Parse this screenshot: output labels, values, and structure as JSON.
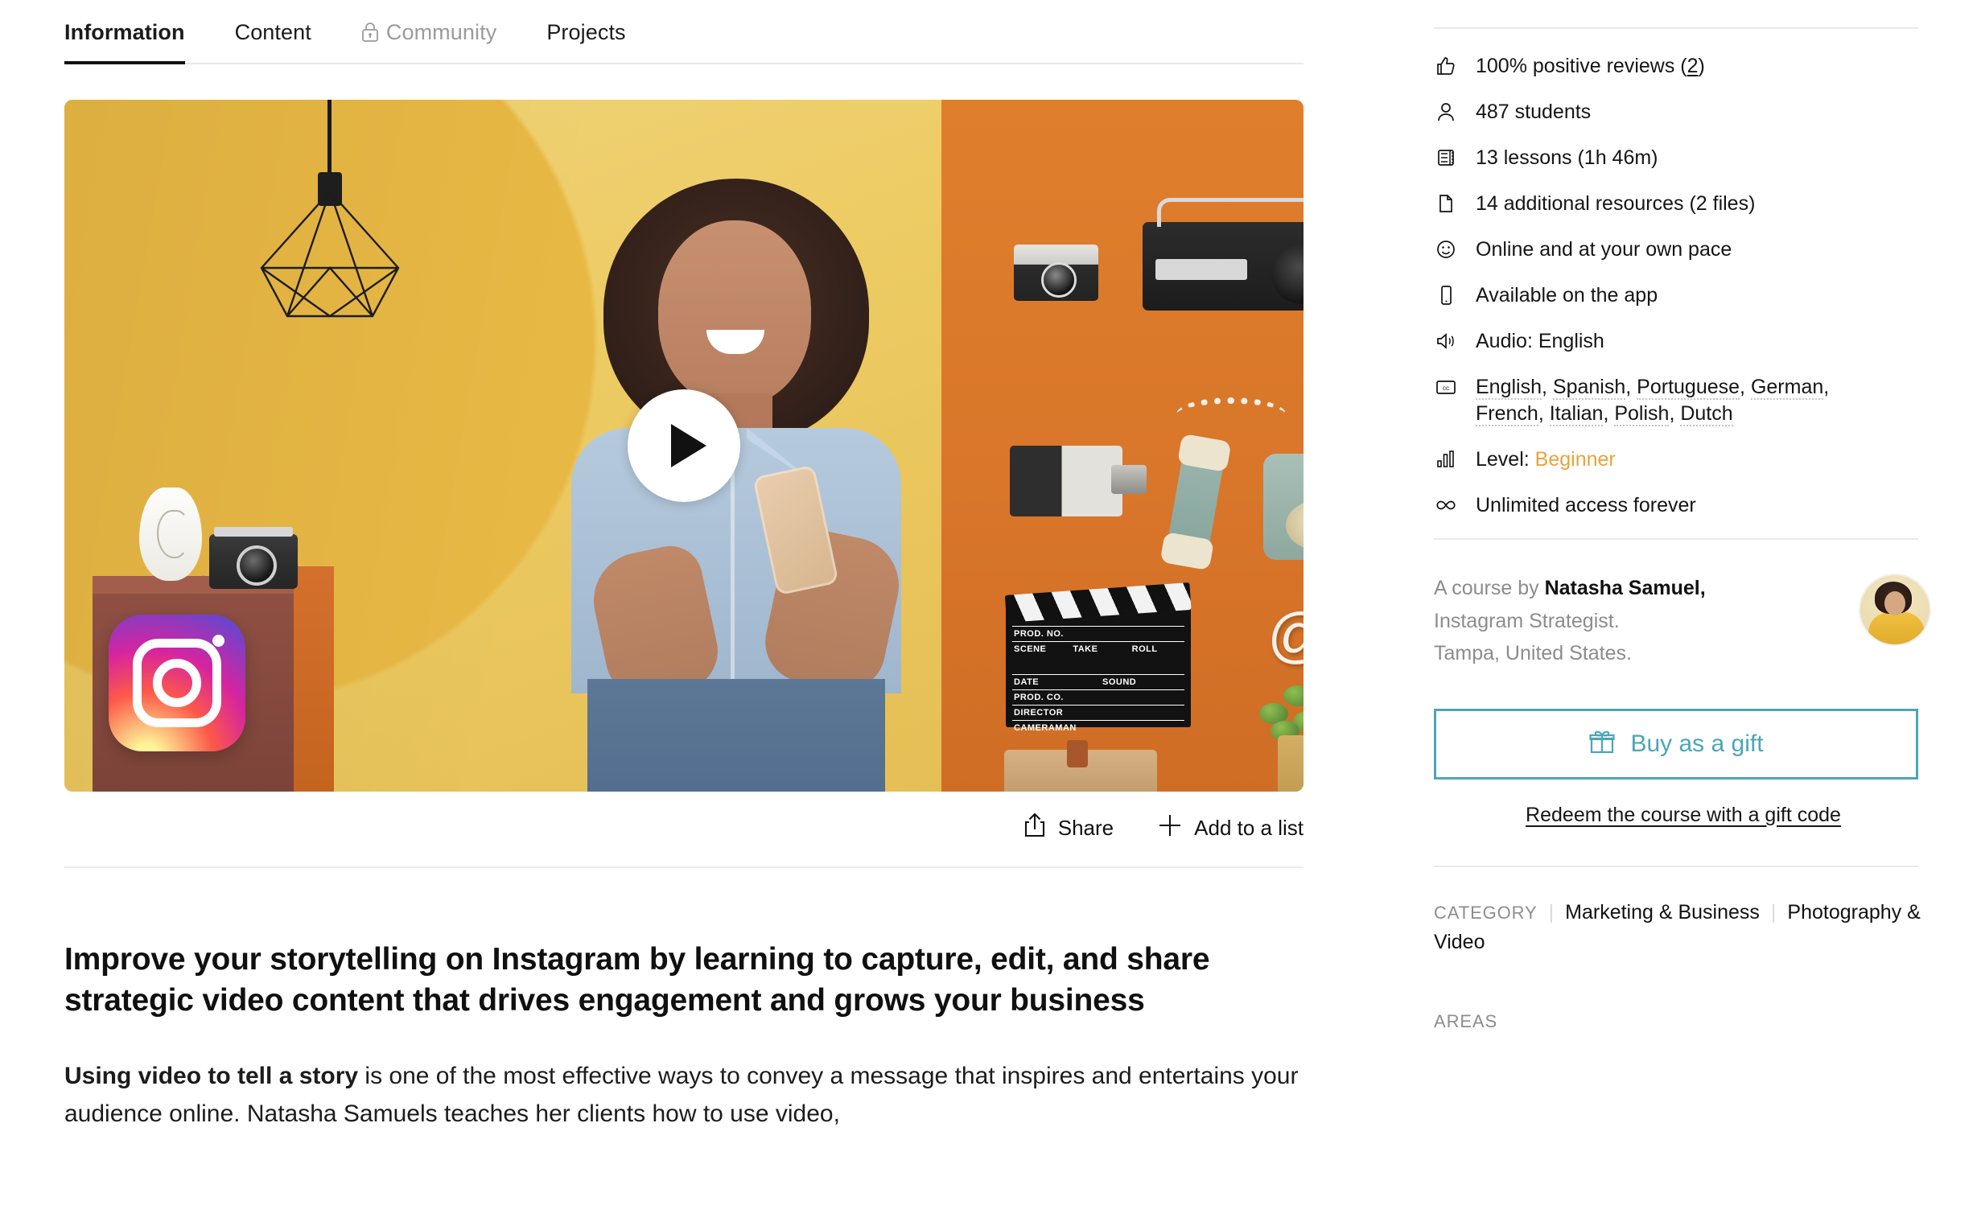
{
  "tabs": [
    {
      "label": "Information",
      "active": true,
      "locked": false
    },
    {
      "label": "Content",
      "active": false,
      "locked": false
    },
    {
      "label": "Community",
      "active": false,
      "locked": true
    },
    {
      "label": "Projects",
      "active": false,
      "locked": false
    }
  ],
  "hero": {
    "play_label": "Play",
    "instagram_logo": "instagram-logo",
    "clapperboard": {
      "prod_no": "PROD. NO.",
      "scene": "SCENE",
      "take": "TAKE",
      "roll": "ROLL",
      "date": "DATE",
      "sound": "SOUND",
      "prod_co": "PROD. CO.",
      "director": "DIRECTOR",
      "cameraman": "CAMERAMAN"
    },
    "at_sign": "@"
  },
  "actions": {
    "share": "Share",
    "add_to_list": "Add to a list"
  },
  "description": {
    "heading": "Improve your storytelling on Instagram by learning to capture, edit, and share strategic video content that drives engagement and grows your business",
    "paragraph_bold": "Using video to tell a story",
    "paragraph_rest": " is one of the most effective ways to convey a message that inspires and entertains your audience online. Natasha Samuels teaches her clients how to use video,"
  },
  "facts": [
    {
      "icon": "thumbs-up-icon",
      "text": "100% positive reviews (",
      "link": "2",
      "suffix": ")"
    },
    {
      "icon": "person-icon",
      "text": "487 students"
    },
    {
      "icon": "film-icon",
      "text": "13 lessons (1h 46m)"
    },
    {
      "icon": "document-icon",
      "text": "14 additional resources (2 files)"
    },
    {
      "icon": "smiley-icon",
      "text": "Online and at your own pace"
    },
    {
      "icon": "mobile-icon",
      "text": "Available on the app"
    },
    {
      "icon": "speaker-icon",
      "text": "Audio: English"
    },
    {
      "icon": "closed-caption-icon",
      "subtitles": [
        "English",
        "Spanish",
        "Portuguese",
        "German",
        "French",
        "Italian",
        "Polish",
        "Dutch"
      ]
    },
    {
      "icon": "bar-chart-icon",
      "text": "Level: ",
      "value": "Beginner"
    },
    {
      "icon": "infinity-icon",
      "text": "Unlimited access forever"
    }
  ],
  "author": {
    "prefix": "A course by ",
    "name": "Natasha Samuel,",
    "role": "Instagram Strategist.",
    "location": "Tampa, United States."
  },
  "cta": {
    "gift_icon": "gift-icon",
    "gift_label": "Buy as a gift",
    "redeem_label": "Redeem the course with a gift code"
  },
  "meta": {
    "category_label": "CATEGORY",
    "categories": [
      "Marketing & Business",
      "Photography & Video"
    ],
    "areas_label": "AREAS"
  },
  "colors": {
    "teal": "#4BA6B5",
    "amber": "#E8A33D",
    "text": "#111111",
    "muted": "#8C8C8C"
  }
}
